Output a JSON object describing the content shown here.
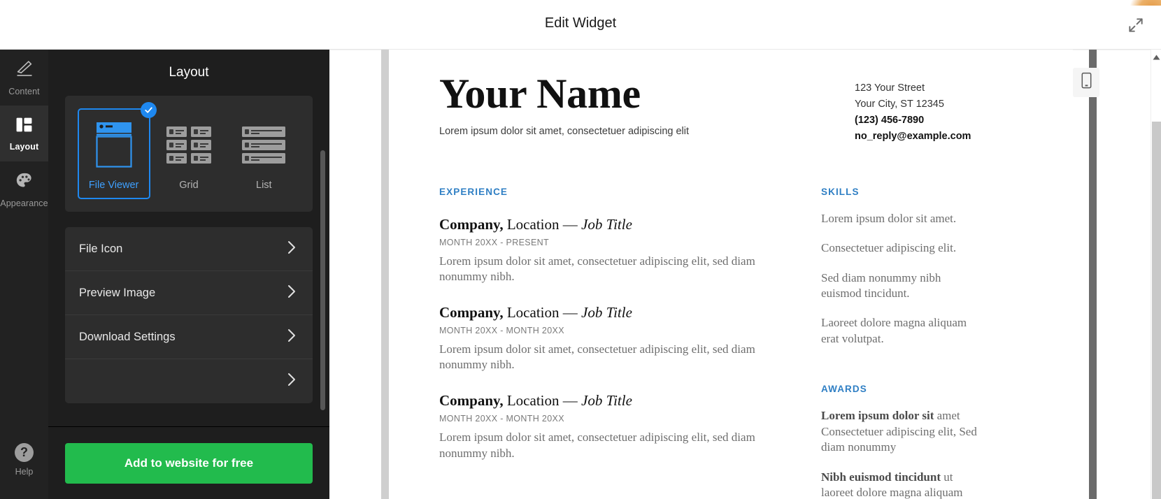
{
  "topbar": {
    "title": "Edit Widget",
    "expand_icon": "expand-arrows-icon"
  },
  "rail": {
    "items": [
      {
        "label": "Content",
        "icon": "pencil-icon",
        "active": false
      },
      {
        "label": "Layout",
        "icon": "layout-columns-icon",
        "active": true
      },
      {
        "label": "Appearance",
        "icon": "palette-icon",
        "active": false
      }
    ],
    "help": {
      "label": "Help",
      "icon": "question-circle-icon"
    }
  },
  "panel": {
    "header": "Layout",
    "layout_options": [
      {
        "label": "File Viewer",
        "icon": "file-viewer-thumb-icon",
        "selected": true
      },
      {
        "label": "Grid",
        "icon": "grid-thumb-icon",
        "selected": false
      },
      {
        "label": "List",
        "icon": "list-thumb-icon",
        "selected": false
      }
    ],
    "check_icon": "check-icon",
    "rows": [
      {
        "label": "File Icon",
        "chevron": "chevron-right-icon"
      },
      {
        "label": "Preview Image",
        "chevron": "chevron-right-icon"
      },
      {
        "label": "Download Settings",
        "chevron": "chevron-right-icon"
      }
    ],
    "cta": "Add to website for free"
  },
  "preview": {
    "mobile_icon": "mobile-phone-icon",
    "scroll_up_icon": "caret-up-icon"
  },
  "resume": {
    "name": "Your Name",
    "tagline": "Lorem ipsum dolor sit amet, consectetuer adipiscing elit",
    "contact": [
      {
        "text": "123 Your Street",
        "bold": false
      },
      {
        "text": "Your City, ST 12345",
        "bold": false
      },
      {
        "text": "(123) 456-7890",
        "bold": true
      },
      {
        "text": "no_reply@example.com",
        "bold": true
      }
    ],
    "experience": {
      "heading": "EXPERIENCE",
      "jobs": [
        {
          "company": "Company,",
          "location": "Location",
          "dash": "—",
          "job_title": "Job Title",
          "dates": "MONTH 20XX - PRESENT",
          "description": "Lorem ipsum dolor sit amet, consectetuer adipiscing elit, sed diam nonummy nibh."
        },
        {
          "company": "Company,",
          "location": "Location",
          "dash": "—",
          "job_title": "Job Title",
          "dates": "MONTH 20XX - MONTH 20XX",
          "description": "Lorem ipsum dolor sit amet, consectetuer adipiscing elit, sed diam nonummy nibh."
        },
        {
          "company": "Company,",
          "location": "Location",
          "dash": "—",
          "job_title": "Job Title",
          "dates": "MONTH 20XX - MONTH 20XX",
          "description": "Lorem ipsum dolor sit amet, consectetuer adipiscing elit, sed diam nonummy nibh."
        }
      ]
    },
    "skills": {
      "heading": "SKILLS",
      "items": [
        "Lorem ipsum dolor sit amet.",
        "Consectetuer adipiscing elit.",
        "Sed diam nonummy nibh euismod tincidunt.",
        "Laoreet dolore magna aliquam erat volutpat."
      ]
    },
    "awards": {
      "heading": "AWARDS",
      "items": [
        {
          "strong": "Lorem ipsum dolor sit",
          "rest": " amet Consectetuer adipiscing elit, Sed diam nonummy"
        },
        {
          "strong": "Nibh euismod tincidunt",
          "rest": " ut laoreet dolore magna aliquam"
        }
      ]
    }
  },
  "colors": {
    "accent_blue": "#2f7fc4",
    "select_blue": "#1e88f0",
    "cta_green": "#22bb4d",
    "panel_bg": "#1e1e1e",
    "rail_bg": "#222222"
  }
}
